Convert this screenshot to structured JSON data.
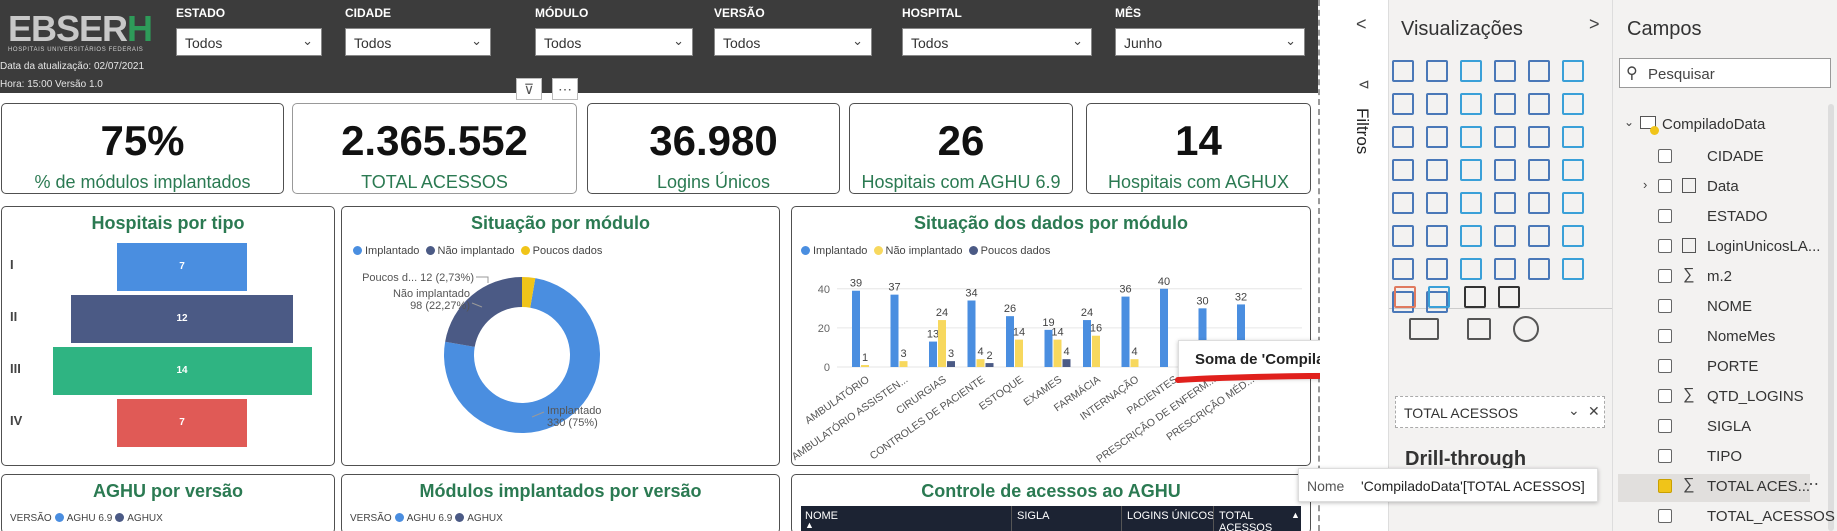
{
  "header": {
    "logo": "EBSER",
    "logo_h": "H",
    "logo_sub": "HOSPITAIS UNIVERSITÁRIOS FEDERAIS",
    "update_date": "Data da atualização: 02/07/2021",
    "update_time": "Hora: 15:00 Versão 1.0",
    "filters": [
      {
        "label": "ESTADO",
        "value": "Todos"
      },
      {
        "label": "CIDADE",
        "value": "Todos"
      },
      {
        "label": "MÓDULO",
        "value": "Todos"
      },
      {
        "label": "VERSÃO",
        "value": "Todos"
      },
      {
        "label": "HOSPITAL",
        "value": "Todos"
      },
      {
        "label": "MÊS",
        "value": "Junho"
      }
    ]
  },
  "kpis": [
    {
      "value": "75%",
      "label": "% de módulos implantados"
    },
    {
      "value": "2.365.552",
      "label": "TOTAL ACESSOS"
    },
    {
      "value": "36.980",
      "label": "Logins Únicos"
    },
    {
      "value": "26",
      "label": "Hospitais com AGHU 6.9"
    },
    {
      "value": "14",
      "label": "Hospitais com AGHUX"
    }
  ],
  "hosp_tipo": {
    "title": "Hospitais por tipo",
    "rows": [
      {
        "label": "I",
        "value": 7,
        "color": "#4a8ee0"
      },
      {
        "label": "II",
        "value": 12,
        "color": "#4b5a85"
      },
      {
        "label": "III",
        "value": 14,
        "color": "#2fb482"
      },
      {
        "label": "IV",
        "value": 7,
        "color": "#e05a56"
      }
    ]
  },
  "situacao": {
    "title": "Situação por módulo",
    "legend": [
      "Implantado",
      "Não implantado",
      "Poucos dados"
    ],
    "colors": [
      "#4a8ee0",
      "#4b5a85",
      "#f0c419"
    ],
    "chart_data": {
      "type": "pie",
      "labels": [
        "Implantado",
        "Não implantado",
        "Poucos dados"
      ],
      "values": [
        330,
        98,
        12
      ],
      "pct": [
        "75%",
        "22,27%",
        "2,73%"
      ]
    },
    "lbl_poucos": "Poucos d... 12 (2,73%)",
    "lbl_nao1": "Não implantado",
    "lbl_nao2": "98 (22,27%)",
    "lbl_imp1": "Implantado",
    "lbl_imp2": "330 (75%)"
  },
  "dados": {
    "title": "Situação dos dados por módulo",
    "legend": [
      "Implantado",
      "Não implantado",
      "Poucos dados"
    ],
    "chart_data": {
      "type": "bar",
      "categories": [
        "AMBULATÓRIO",
        "AMBULATÓRIO ASSISTEN...",
        "CIRURGIAS",
        "CONTROLES DE PACIENTE",
        "ESTOQUE",
        "EXAMES",
        "FARMÁCIA",
        "INTERNAÇÃO",
        "PACIENTES",
        "PRESCRIÇÃO DE ENFERM...",
        "PRESCRIÇÃO MÉD..."
      ],
      "series": [
        {
          "name": "Implantado",
          "values": [
            39,
            37,
            13,
            34,
            26,
            19,
            24,
            36,
            40,
            30,
            32
          ]
        },
        {
          "name": "Não implantado",
          "values": [
            1,
            3,
            24,
            4,
            14,
            14,
            16,
            4,
            null,
            null,
            null
          ]
        },
        {
          "name": "Poucos dados",
          "values": [
            null,
            null,
            3,
            2,
            null,
            4,
            null,
            null,
            null,
            null,
            null
          ]
        }
      ],
      "yticks": [
        0,
        20,
        40
      ],
      "ylim": [
        0,
        45
      ]
    }
  },
  "tooltip": {
    "text": "Soma de 'CompiladoData'[TOTAL ACESSOS]"
  },
  "aghu_versao": {
    "title": "AGHU por versão",
    "leg_title": "VERSÃO",
    "legend": [
      "AGHU 6.9",
      "AGHUX"
    ]
  },
  "mod_versao": {
    "title": "Módulos implantados por versão",
    "leg_title": "VERSÃO",
    "legend": [
      "AGHU 6.9",
      "AGHUX"
    ]
  },
  "controle": {
    "title": "Controle de acessos ao AGHU",
    "columns": [
      "NOME",
      "SIGLA",
      "LOGINS ÚNICOS",
      "TOTAL ACESSOS"
    ]
  },
  "filters_pane": {
    "label": "Filtros"
  },
  "viz": {
    "title": "Visualizações",
    "field_value": "TOTAL ACESSOS",
    "drill": "Drill-through",
    "name_label": "Nome",
    "name_value": "'CompiladoData'[TOTAL ACESSOS]"
  },
  "fields": {
    "title": "Campos",
    "search_placeholder": "Pesquisar",
    "table": "CompiladoData",
    "items": [
      "CIDADE",
      "Data",
      "ESTADO",
      "LoginUnicosLA...",
      "m.2",
      "NOME",
      "NomeMes",
      "PORTE",
      "QTD_LOGINS",
      "SIGLA",
      "TIPO",
      "TOTAL ACES...",
      "TOTAL_ACESSOS"
    ]
  }
}
